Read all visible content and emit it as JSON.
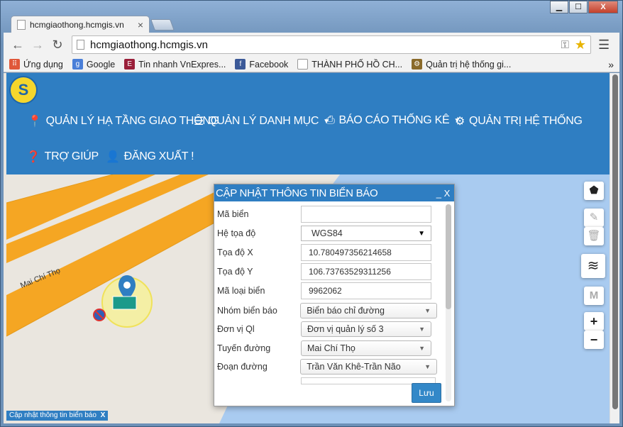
{
  "window": {
    "minimize": "▁",
    "maximize": "☐",
    "close": "X"
  },
  "tab": {
    "title": "hcmgiaothong.hcmgis.vn",
    "close": "×"
  },
  "toolbar": {
    "url": "hcmgiaothong.hcmgis.vn"
  },
  "bookmarks": [
    {
      "label": "Ứng dụng",
      "icon": "apps-grid-icon",
      "color": "#e0583a"
    },
    {
      "label": "Google",
      "icon": "google-icon",
      "color": "#4a7fd8"
    },
    {
      "label": "Tin nhanh VnExpres...",
      "icon": "vnexpress-icon",
      "color": "#9a1f3a"
    },
    {
      "label": "Facebook",
      "icon": "facebook-icon",
      "color": "#3b5998"
    },
    {
      "label": "THÀNH PHỐ HỒ CH...",
      "icon": "page-icon",
      "color": "#999999"
    },
    {
      "label": "Quản trị hệ thống gi...",
      "icon": "admin-icon",
      "color": "#8a6a2a"
    }
  ],
  "nav": {
    "items": [
      {
        "label": "QUẢN LÝ HẠ TẦNG GIAO THÔNG",
        "icon": "map-marker-icon"
      },
      {
        "label": "QUẢN LÝ DANH MỤC",
        "icon": "list-icon",
        "caret": true
      },
      {
        "label": "BÁO CÁO THỐNG KÊ",
        "icon": "print-icon",
        "caret": true
      },
      {
        "label": "QUẢN TRỊ HỆ THỐNG",
        "icon": "gear-icon"
      },
      {
        "label": "TRỢ GIÚP",
        "icon": "question-icon"
      },
      {
        "label": "ĐĂNG XUẤT !",
        "icon": "user-icon"
      }
    ]
  },
  "map": {
    "street_label": "Mai Chí Thọ",
    "colors": {
      "road": "#f5a623",
      "water": "#a9cbf0",
      "land": "#eae6df"
    }
  },
  "dialog": {
    "title": "CẬP NHẬT THÔNG TIN BIỂN BÁO",
    "minimize": "_",
    "close": "X",
    "fields": {
      "ma_bien": {
        "label": "Mã biển",
        "value": ""
      },
      "he_toa_do": {
        "label": "Hệ tọa độ",
        "value": "WGS84"
      },
      "toa_do_x": {
        "label": "Tọa độ X",
        "value": "10.780497356214658"
      },
      "toa_do_y": {
        "label": "Tọa độ Y",
        "value": "106.73763529311256"
      },
      "ma_loai_bien": {
        "label": "Mã loại biển",
        "value": "9962062"
      },
      "nhom_bien_bao": {
        "label": "Nhóm biển báo",
        "value": "Biển báo chỉ đường"
      },
      "don_vi_ql": {
        "label": "Đơn vị Ql",
        "value": "Đơn vị quản lý số 3"
      },
      "tuyen_duong": {
        "label": "Tuyến đường",
        "value": "Mai Chí Thọ"
      },
      "doan_duong": {
        "label": "Đoạn đường",
        "value": "Trần Văn Khê-Trần Não"
      }
    },
    "save_label": "Lưu"
  },
  "statusbar": {
    "label": "Cập nhật thông tin biển báo",
    "close": "X"
  }
}
